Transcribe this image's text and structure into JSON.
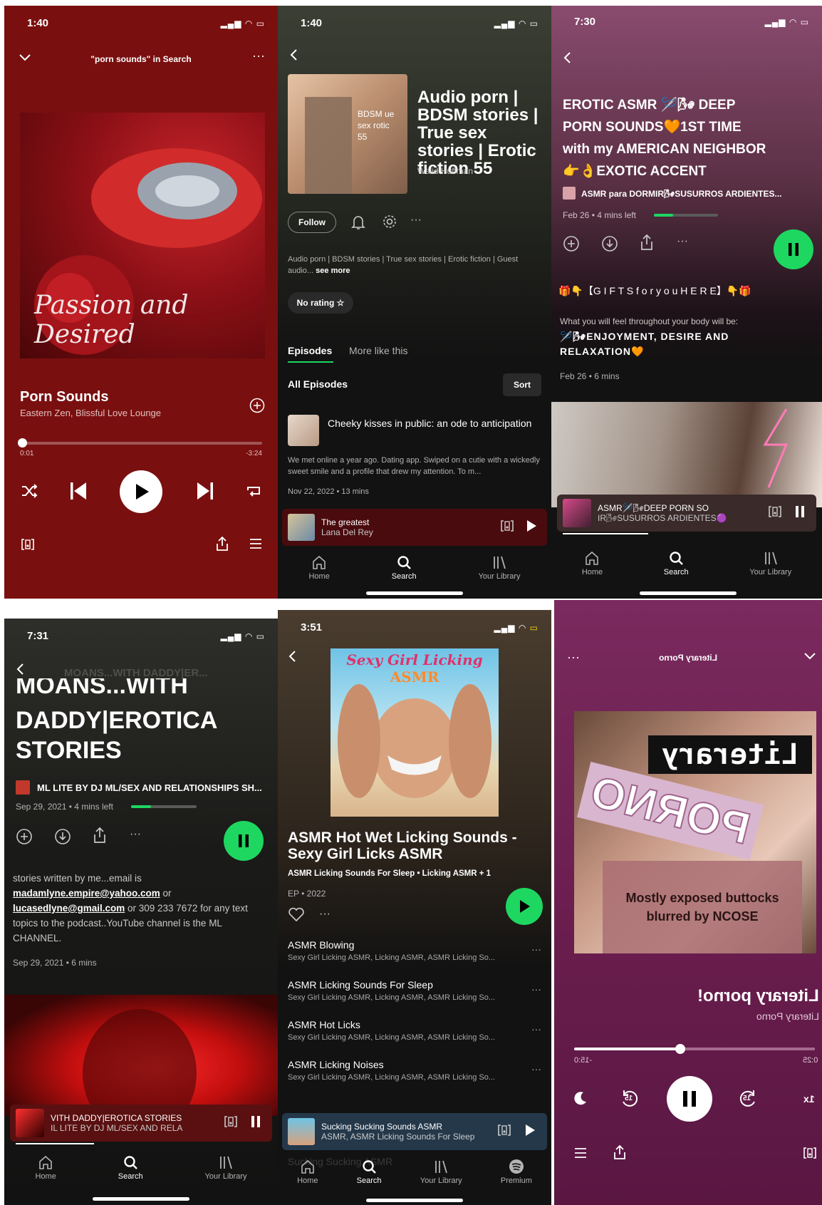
{
  "panel1": {
    "time": "1:40",
    "header_title": "\"porn sounds\" in Search",
    "art_caption": "Passion and Desired",
    "track_title": "Porn Sounds",
    "track_artist": "Eastern Zen, Blissful Love Lounge",
    "elapsed": "0:01",
    "remaining": "-3:24",
    "progress": 0.01,
    "bg_color": "#7a0f0f"
  },
  "panel2": {
    "time": "1:40",
    "show_title": "Audio porn | BDSM stories | True sex stories | Erotic fiction 55",
    "author": "Walid Huffman",
    "art_text": "BDSM ue sex rotic 55",
    "follow_label": "Follow",
    "description": "Audio porn | BDSM stories | True sex stories | Erotic fiction | Guest audio...",
    "see_more": "see more",
    "rating_label": "No rating",
    "tab_episodes": "Episodes",
    "tab_more": "More like this",
    "all_episodes": "All Episodes",
    "sort_label": "Sort",
    "episode": {
      "title": "Cheeky kisses in public: an ode to anticipation",
      "desc": "We met online a year ago. Dating app. Swiped on a cutie with a wickedly sweet smile and a profile that drew my attention. To m...",
      "meta": "Nov 22, 2022 • 13 mins"
    },
    "mini_title": "The greatest",
    "mini_artist": "Lana Del Rey",
    "nav": [
      "Home",
      "Search",
      "Your Library"
    ]
  },
  "panel3": {
    "time": "7:30",
    "title_l1": "EROTIC ASMR 🪡🌬 DEEP",
    "title_l2": "PORN SOUNDS🧡1ST TIME",
    "title_l3": "with my AMERICAN NEIGHBOR",
    "title_l4": "👉👌EXOTIC ACCENT",
    "show_name": "ASMR para DORMIR🌬SUSURROS ARDIENTES...",
    "meta": "Feb 26 • 4 mins left",
    "progress": 0.3,
    "gifts_line": "🎁👇【G I F T S   f o r   y o u   H E R E】👇🎁",
    "feel_line": "What you will feel throughout your body will be:",
    "enjoy_line": "🪡🌬ENJOYMENT, DESIRE AND",
    "relax_line": "RELAXATION🧡",
    "meta2": "Feb 26 • 6 mins",
    "mini_title": "ASMR🪡🌬DEEP PORN SO",
    "mini_sub": "IR🌬SUSURROS ARDIENTES🟣",
    "nav": [
      "Home",
      "Search",
      "Your Library"
    ]
  },
  "panel4": {
    "time": "7:31",
    "header_faded": "MOANS...WITH DADDY|ER...",
    "title_cut": "MOANS...WITH",
    "title_l2": "DADDY|EROTICA",
    "title_l3": "STORIES",
    "show_name": "ML LITE BY DJ ML/SEX AND RELATIONSHIPS SH...",
    "meta": "Sep 29, 2021 • 4 mins left",
    "progress": 0.3,
    "desc1": "stories written by me...email is",
    "email1": "madamlyne.empire@yahoo.com",
    "or1": "or",
    "email2": "lucasedlyne@gmail.com",
    "desc2": "or 309 233 7672 for any text",
    "desc3": "topics to the podcast..YouTube channel is the ML",
    "desc4": "CHANNEL.",
    "meta2": "Sep 29, 2021 • 6 mins",
    "mini_title": "VITH DADDY|EROTICA STORIES",
    "mini_sub": "IL LITE BY DJ ML/SEX AND RELA",
    "nav": [
      "Home",
      "Search",
      "Your Library"
    ]
  },
  "panel5": {
    "time": "3:51",
    "art_title": "Sexy Girl Licking",
    "art_sub": "ASMR",
    "album_title": "ASMR Hot Wet Licking Sounds - Sexy Girl Licks ASMR",
    "artists": "ASMR Licking Sounds For Sleep • Licking ASMR + 1",
    "type": "EP • 2022",
    "tracks": [
      {
        "title": "ASMR Blowing",
        "sub": "Sexy Girl Licking ASMR, Licking ASMR, ASMR Licking So..."
      },
      {
        "title": "ASMR Licking Sounds For Sleep",
        "sub": "Sexy Girl Licking ASMR, Licking ASMR, ASMR Licking So..."
      },
      {
        "title": "ASMR Hot Licks",
        "sub": "Sexy Girl Licking ASMR, Licking ASMR, ASMR Licking So..."
      },
      {
        "title": "ASMR Licking Noises",
        "sub": "Sexy Girl Licking ASMR, Licking ASMR, ASMR Licking So..."
      }
    ],
    "mini_title": "Sucking Sucking Sounds ASMR",
    "mini_sub": "ASMR, ASMR Licking Sounds For Sleep",
    "faded_track": "Sucking Sucking ASMR",
    "nav": [
      "Home",
      "Search",
      "Your Library",
      "Premium"
    ]
  },
  "panel6": {
    "header_title": "Literary Porno",
    "art_word": "Literary",
    "art_porn": "PORNO",
    "overlay_note": "Mostly exposed buttocks blurred by NCOSE",
    "track_title": "Literary porno!",
    "track_artist": "Literary Porno",
    "elapsed": "-15:0",
    "remaining": "0:25",
    "progress": 0.56,
    "speed": "1x",
    "skip_back": "15",
    "skip_fwd": "15",
    "bg_color": "#6b1e4f"
  }
}
